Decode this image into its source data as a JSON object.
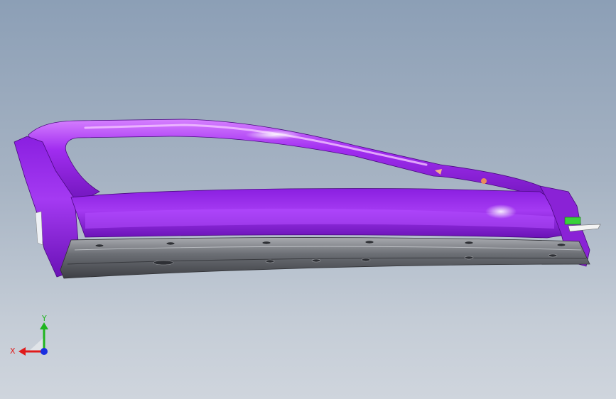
{
  "viewport": {
    "background_top": "#8c9fb6",
    "background_bottom": "#cfd5dd"
  },
  "model": {
    "part_color": "#9a1fe8",
    "part_highlight": "#e59cff",
    "rail_color": "#5a5d63",
    "accent_green": "#39d13a",
    "accent_orange": "#e88b5a"
  },
  "triad": {
    "x_label": "X",
    "y_label": "Y",
    "x_color": "#e01a1a",
    "y_color": "#1fb51f",
    "z_color": "#1a2fe0"
  }
}
